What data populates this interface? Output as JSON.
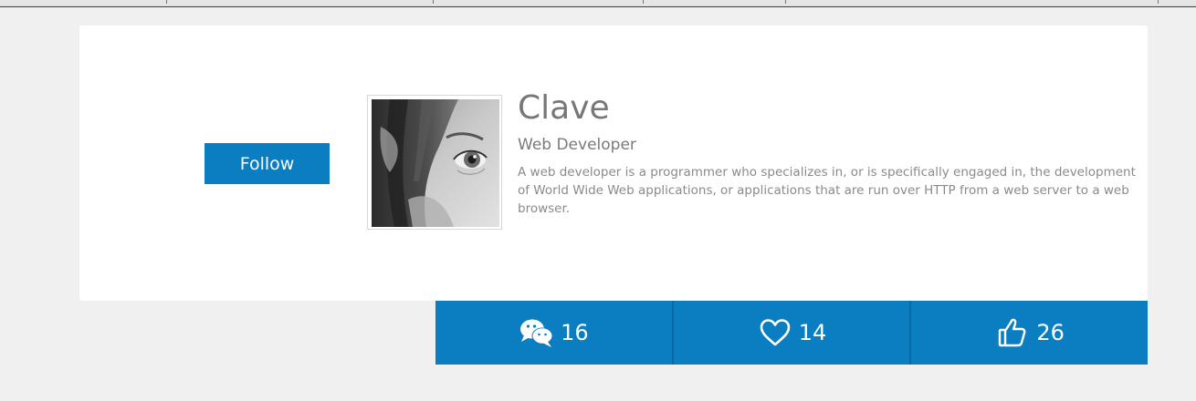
{
  "profile": {
    "name": "Clave",
    "role": "Web Developer",
    "bio": "A web developer is a programmer who specializes in, or is specifically engaged in, the development of World Wide Web applications, or applications that are run over HTTP from a web server to a web browser.",
    "follow_label": "Follow",
    "avatar": "grayscale-portrait"
  },
  "stats": [
    {
      "icon": "chat-bubbles-icon",
      "count": "16"
    },
    {
      "icon": "heart-icon",
      "count": "14"
    },
    {
      "icon": "thumbs-up-icon",
      "count": "26"
    }
  ],
  "colors": {
    "accent": "#0b7dc1",
    "background": "#f0f0f0",
    "card": "#ffffff",
    "name_text": "#777777"
  }
}
